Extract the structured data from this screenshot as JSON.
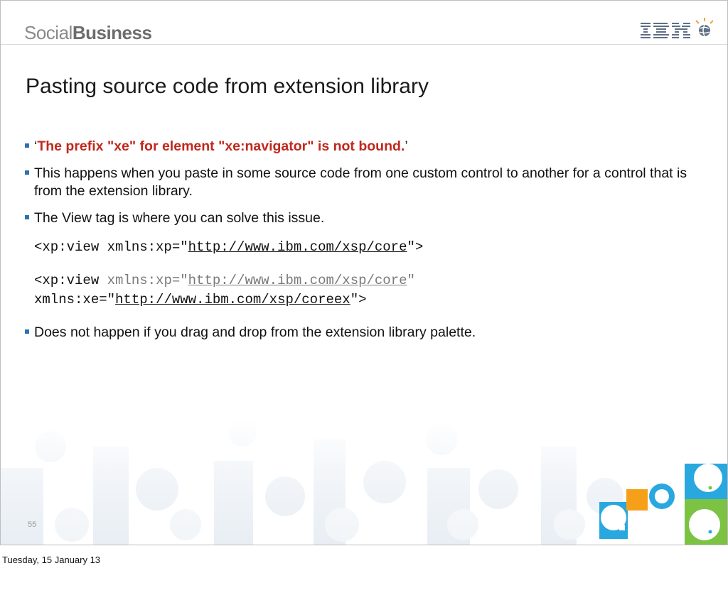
{
  "header": {
    "brand_light": "Social",
    "brand_bold": "Business",
    "logo_text": "IBM"
  },
  "slide": {
    "title": "Pasting source code from extension library",
    "bullet1": {
      "open_quote": "‘",
      "error_text": "The prefix \"xe\" for element \"xe:navigator\" is not bound.",
      "close_quote": "’"
    },
    "bullet2": "This happens when you paste in some source code from one custom control to another for a control that is from the extension library.",
    "bullet3": "The View tag is where you can solve this issue.",
    "code1": {
      "prefix": "<xp:view xmlns:xp=\"",
      "url": "http://www.ibm.com/xsp/core",
      "suffix": "\">"
    },
    "code2": {
      "prefix": "<xp:view ",
      "attr_grey": "xmlns:xp=\"",
      "url": "http://www.ibm.com/xsp/core",
      "quote_grey": "\""
    },
    "code3": {
      "prefix": "xmlns:xe=\"",
      "url": "http://www.ibm.com/xsp/coreex",
      "suffix": "\">"
    },
    "bullet4": "Does not happen if you drag and drop from the extension library palette.",
    "page_number": "55"
  },
  "footer": {
    "date": "Tuesday, 15 January 13"
  },
  "colors": {
    "accent_blue": "#2a72b5",
    "error_red": "#c0281e"
  }
}
